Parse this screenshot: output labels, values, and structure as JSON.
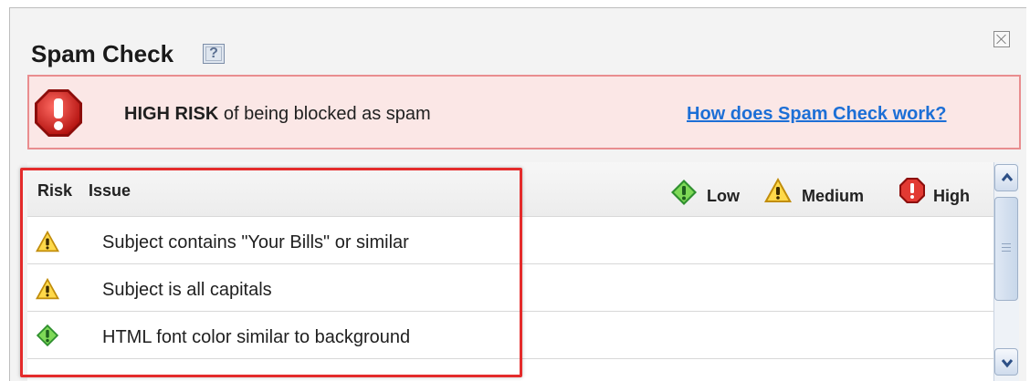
{
  "dialog": {
    "title": "Spam Check",
    "help_icon": "help-icon",
    "help_label": "?",
    "close_icon": "close-icon"
  },
  "alert": {
    "icon": "stop-warning-icon",
    "risk_level": "HIGH RISK",
    "message": " of being blocked as spam",
    "link": "How does Spam Check work?",
    "colors": {
      "background": "#fbe7e6",
      "border": "#e98d8f",
      "link": "#1c6fd6"
    }
  },
  "table": {
    "columns": {
      "risk": "Risk",
      "issue": "Issue"
    },
    "legend": [
      {
        "icon": "low-risk-icon",
        "label": "Low"
      },
      {
        "icon": "medium-risk-icon",
        "label": "Medium"
      },
      {
        "icon": "high-risk-icon",
        "label": "High"
      }
    ],
    "rows": [
      {
        "risk": "medium",
        "risk_icon": "medium-risk-icon",
        "issue": "Subject contains \"Your Bills\" or similar"
      },
      {
        "risk": "medium",
        "risk_icon": "medium-risk-icon",
        "issue": "Subject is all capitals"
      },
      {
        "risk": "low",
        "risk_icon": "low-risk-icon",
        "issue": "HTML font color similar to background"
      }
    ]
  },
  "scrollbar": {
    "up_icon": "chevron-up-icon",
    "down_icon": "chevron-down-icon"
  },
  "colors": {
    "highlight": "#e42b2b",
    "low": "#3aa63a",
    "medium": "#f2c12e",
    "high": "#d62b2b"
  }
}
